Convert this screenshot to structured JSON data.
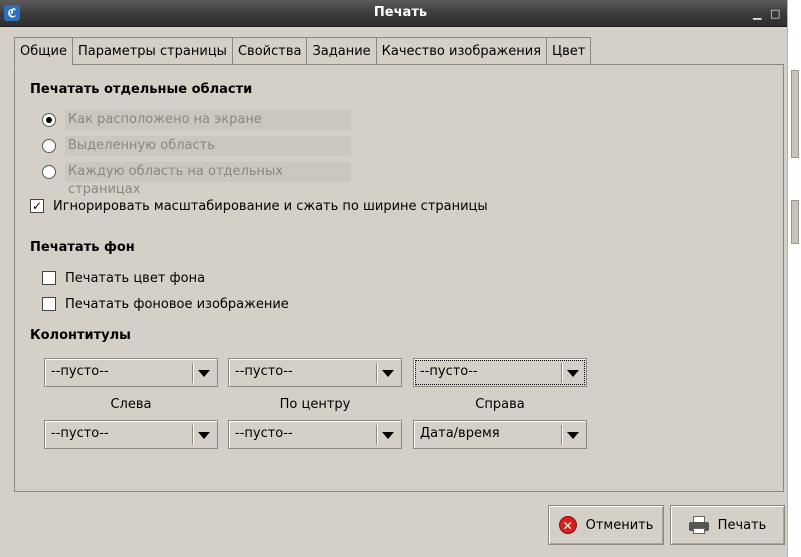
{
  "window": {
    "title": "Печать",
    "icon": "konqueror-icon"
  },
  "tabs": [
    {
      "label": "Общие",
      "active": true
    },
    {
      "label": "Параметры страницы",
      "active": false
    },
    {
      "label": "Свойства",
      "active": false
    },
    {
      "label": "Задание",
      "active": false
    },
    {
      "label": "Качество изображения",
      "active": false
    },
    {
      "label": "Цвет",
      "active": false
    }
  ],
  "print_frames": {
    "title": "Печатать отдельные области",
    "options": [
      {
        "label": "Как расположено на экране",
        "checked": true,
        "enabled": false
      },
      {
        "label": "Выделенную область",
        "checked": false,
        "enabled": false
      },
      {
        "label": "Каждую область на отдельных страницах",
        "checked": false,
        "enabled": false
      }
    ]
  },
  "ignore_scaling": {
    "label": "Игнорировать масштабирование и сжать по ширине страницы",
    "checked": true
  },
  "background": {
    "title": "Печатать фон",
    "color": {
      "label": "Печатать цвет фона",
      "checked": false
    },
    "image": {
      "label": "Печатать фоновое изображение",
      "checked": false
    }
  },
  "headers_footers": {
    "title": "Колонтитулы",
    "top": [
      "--пусто--",
      "--пусто--",
      "--пусто--"
    ],
    "labels": [
      "Слева",
      "По центру",
      "Справа"
    ],
    "bottom": [
      "--пусто--",
      "--пусто--",
      "Дата/время"
    ]
  },
  "buttons": {
    "cancel": "Отменить",
    "print": "Печать"
  },
  "colors": {
    "cancel_icon": "#d32020",
    "titlebar": "#3c3c3c"
  }
}
